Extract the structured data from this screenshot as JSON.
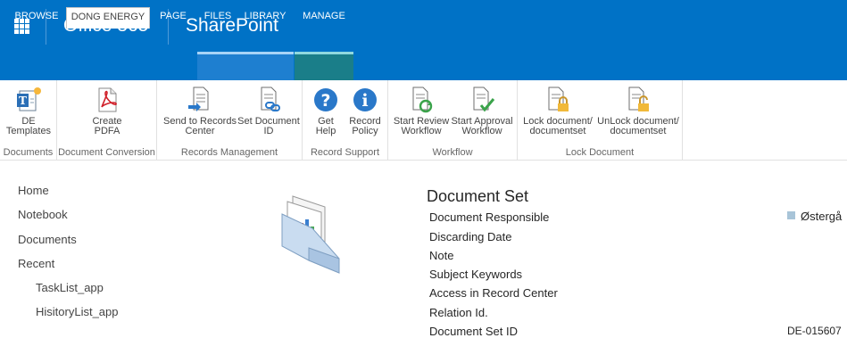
{
  "suite": {
    "app": "Office 365",
    "site": "SharePoint"
  },
  "tabs": [
    {
      "label": "BROWSE"
    },
    {
      "label": "DONG ENERGY"
    },
    {
      "label": "PAGE"
    },
    {
      "label": "FILES"
    },
    {
      "label": "LIBRARY"
    },
    {
      "label": "MANAGE"
    }
  ],
  "ribbon": {
    "groups": [
      {
        "label": "Documents",
        "buttons": [
          {
            "l1": "DE",
            "l2": "Templates"
          }
        ]
      },
      {
        "label": "Document Conversion",
        "buttons": [
          {
            "l1": "Create",
            "l2": "PDFA"
          }
        ]
      },
      {
        "label": "Records Management",
        "buttons": [
          {
            "l1": "Send to Records",
            "l2": "Center"
          },
          {
            "l1": "Set Document",
            "l2": "ID"
          }
        ]
      },
      {
        "label": "Record Support",
        "buttons": [
          {
            "l1": "Get",
            "l2": "Help"
          },
          {
            "l1": "Record",
            "l2": "Policy"
          }
        ]
      },
      {
        "label": "Workflow",
        "buttons": [
          {
            "l1": "Start Review",
            "l2": "Workflow"
          },
          {
            "l1": "Start Approval",
            "l2": "Workflow"
          }
        ]
      },
      {
        "label": "Lock Document",
        "buttons": [
          {
            "l1": "Lock document/",
            "l2": "documentset"
          },
          {
            "l1": "UnLock document/",
            "l2": "documentset"
          }
        ]
      }
    ]
  },
  "nav": {
    "items": [
      {
        "label": "Home"
      },
      {
        "label": "Notebook"
      },
      {
        "label": "Documents"
      },
      {
        "label": "Recent"
      },
      {
        "label": "TaskList_app"
      },
      {
        "label": "HisitoryList_app"
      }
    ]
  },
  "docset": {
    "title": "Document Set",
    "fields": [
      {
        "name": "Document Responsible"
      },
      {
        "name": "Discarding Date"
      },
      {
        "name": "Note"
      },
      {
        "name": "Subject Keywords"
      },
      {
        "name": "Access in Record Center"
      },
      {
        "name": "Relation Id."
      },
      {
        "name": "Document Set ID"
      }
    ],
    "responsible_value": "Østergå",
    "docset_id_value": "DE-015607"
  },
  "colors": {
    "suite": "#0072c6",
    "files_group": "#1e7fd0",
    "manage_group": "#1a7e89"
  }
}
